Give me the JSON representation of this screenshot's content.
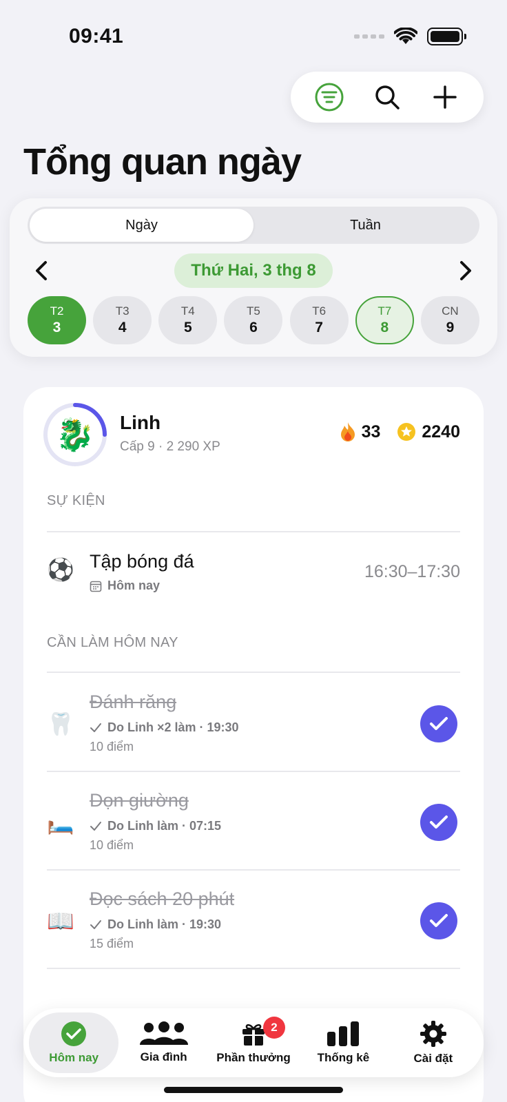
{
  "status_bar": {
    "time": "09:41"
  },
  "top_actions": [
    {
      "icon": "filter-icon",
      "color": "#46a33b"
    },
    {
      "icon": "search-icon"
    },
    {
      "icon": "plus-icon"
    }
  ],
  "page_title": "Tổng quan ngày",
  "segmented": {
    "options": [
      "Ngày",
      "Tuần"
    ],
    "selected": "Ngày"
  },
  "date_nav": {
    "label": "Thứ Hai, 3 thg 8"
  },
  "days": [
    {
      "name": "T2",
      "num": "3",
      "state": "selected"
    },
    {
      "name": "T3",
      "num": "4",
      "state": ""
    },
    {
      "name": "T4",
      "num": "5",
      "state": ""
    },
    {
      "name": "T5",
      "num": "6",
      "state": ""
    },
    {
      "name": "T6",
      "num": "7",
      "state": ""
    },
    {
      "name": "T7",
      "num": "8",
      "state": "today"
    },
    {
      "name": "CN",
      "num": "9",
      "state": ""
    }
  ],
  "profile": {
    "name": "Linh",
    "level": "Cấp 9 · 2 290 XP",
    "avatar_emoji": "🐉",
    "level_progress": 0.25,
    "streak": "33",
    "stars": "2240"
  },
  "events": {
    "header": "SỰ KIỆN",
    "items": [
      {
        "emoji": "⚽",
        "title": "Tập bóng đá",
        "meta": "Hôm nay",
        "time": "16:30–17:30"
      }
    ]
  },
  "todos": {
    "header": "CẦN LÀM HÔM NAY",
    "items": [
      {
        "emoji": "🦷",
        "title": "Đánh răng",
        "meta": "Do Linh ×2 làm · 19:30",
        "points": "10 điểm",
        "done": true
      },
      {
        "emoji": "🛏️",
        "title": "Dọn giường",
        "meta": "Do Linh làm · 07:15",
        "points": "10 điểm",
        "done": true
      },
      {
        "emoji": "📖",
        "title": "Đọc sách 20 phút",
        "meta": "Do Linh làm · 19:30",
        "points": "15 điểm",
        "done": true
      }
    ]
  },
  "tabbar": {
    "tabs": [
      {
        "label": "Hôm nay",
        "icon": "check-circle-icon",
        "active": true
      },
      {
        "label": "Gia đình",
        "icon": "family-icon"
      },
      {
        "label": "Phần thưởng",
        "icon": "gift-icon",
        "badge": "2"
      },
      {
        "label": "Thống kê",
        "icon": "bar-chart-icon"
      },
      {
        "label": "Cài đặt",
        "icon": "gear-icon"
      }
    ]
  },
  "colors": {
    "accent_green": "#46a33b",
    "accent_purple": "#5b56e8",
    "badge_red": "#f0363f"
  }
}
